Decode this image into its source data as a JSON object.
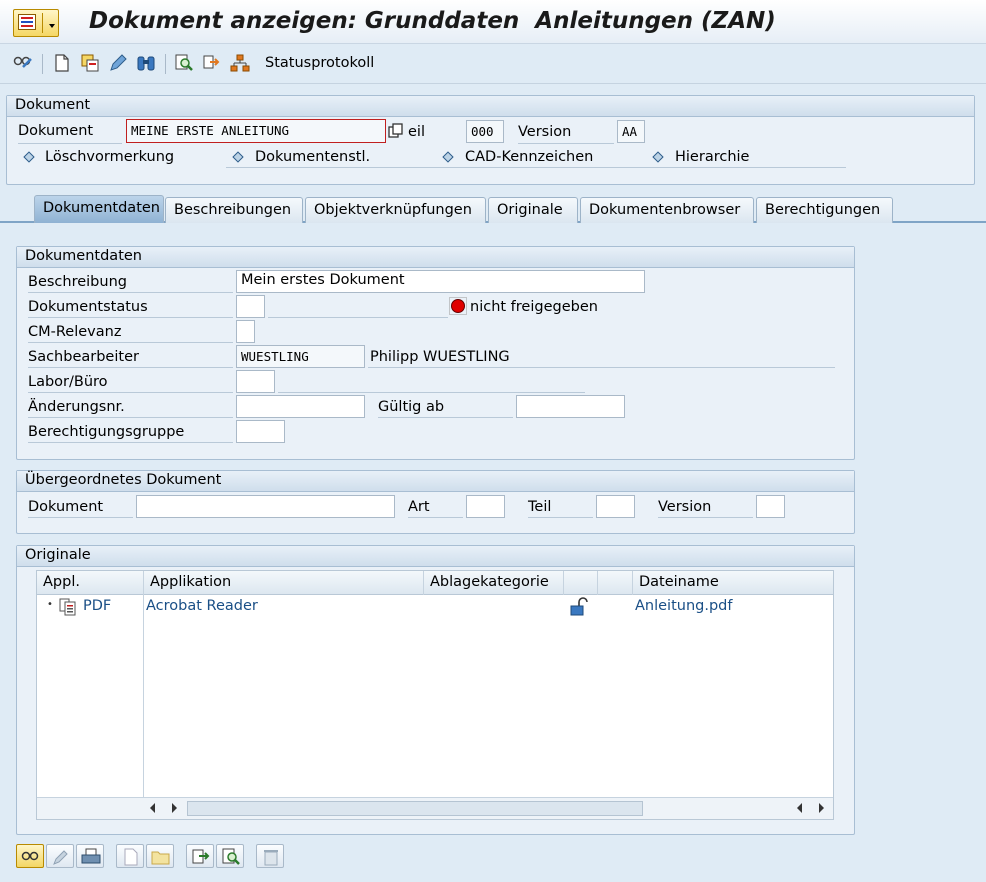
{
  "window": {
    "title": "Dokument anzeigen: Grunddaten  Anleitungen (ZAN)"
  },
  "toolbar": {
    "status_label": "Statusprotokoll"
  },
  "dokument_group": {
    "title": "Dokument",
    "dokument_label": "Dokument",
    "dokument_value": "MEINE ERSTE ANLEITUNG",
    "teil_label": "eil",
    "teil_value": "000",
    "version_label": "Version",
    "version_value": "AA",
    "links": [
      "Löschvormerkung",
      "Dokumentenstl.",
      "CAD-Kennzeichen",
      "Hierarchie"
    ]
  },
  "tabs": [
    "Dokumentdaten",
    "Beschreibungen",
    "Objektverknüpfungen",
    "Originale",
    "Dokumentenbrowser",
    "Berechtigungen"
  ],
  "dokumentdaten": {
    "title": "Dokumentdaten",
    "beschreibung_label": "Beschreibung",
    "beschreibung_value": "Mein erstes Dokument",
    "status_label": "Dokumentstatus",
    "status_text": "nicht freigegeben",
    "status_color": "#e00000",
    "cm_label": "CM-Relevanz",
    "sachbearbeiter_label": "Sachbearbeiter",
    "sachbearbeiter_value": "WUESTLING",
    "sachbearbeiter_name": "Philipp WUESTLING",
    "labor_label": "Labor/Büro",
    "aenderung_label": "Änderungsnr.",
    "gueltig_label": "Gültig ab",
    "berechtigung_label": "Berechtigungsgruppe"
  },
  "uebergeordnet": {
    "title": "Übergeordnetes Dokument",
    "dokument_label": "Dokument",
    "art_label": "Art",
    "teil_label": "Teil",
    "version_label": "Version"
  },
  "originale": {
    "title": "Originale",
    "columns": [
      "Appl.",
      "Applikation",
      "Ablagekategorie",
      "",
      "",
      "Dateiname"
    ],
    "rows": [
      {
        "appl": "PDF",
        "applikation": "Acrobat Reader",
        "ablagekategorie": "",
        "dateiname": "Anleitung.pdf"
      }
    ]
  }
}
